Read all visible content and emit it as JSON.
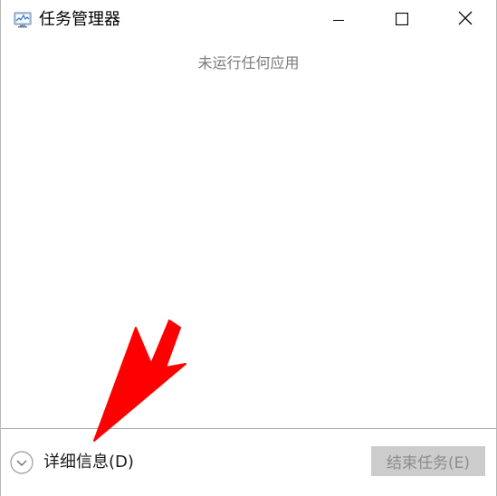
{
  "window": {
    "title": "任务管理器",
    "icon": "task-manager-icon"
  },
  "caption_buttons": {
    "minimize_icon": "minimize-icon",
    "maximize_icon": "maximize-icon",
    "close_icon": "close-icon"
  },
  "main": {
    "empty_message": "未运行任何应用"
  },
  "footer": {
    "details_label": "详细信息(D)",
    "details_icon": "chevron-down-circle-icon",
    "end_task_label": "结束任务(E)",
    "end_task_enabled": false
  },
  "annotation": {
    "type": "arrow",
    "color": "#ff0000",
    "points_to": "details-toggle"
  }
}
